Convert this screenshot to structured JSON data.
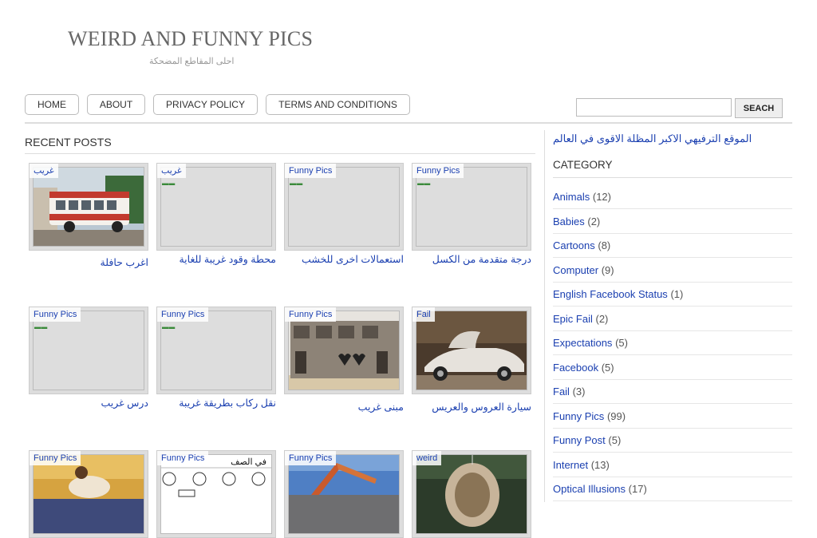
{
  "site": {
    "title": "WEIRD AND FUNNY PICS",
    "description": "احلى المقاطع المضحكة"
  },
  "nav": {
    "items": [
      "HOME",
      "ABOUT",
      "PRIVACY POLICY",
      "TERMS AND CONDITIONS"
    ]
  },
  "search": {
    "button_label": "SEACH",
    "value": ""
  },
  "recent": {
    "heading": "RECENT POSTS",
    "posts": [
      {
        "label": "غريب",
        "title": "اغرب حافلة",
        "image": "bus"
      },
      {
        "label": "غريب",
        "title": "محطة وقود غريبة للغاية",
        "image": "placeholder"
      },
      {
        "label": "Funny Pics",
        "title": "استعمالات اخرى للخشب",
        "image": "placeholder"
      },
      {
        "label": "Funny Pics",
        "title": "درجة متقدمة من الكسل",
        "image": "placeholder"
      },
      {
        "label": "Funny Pics",
        "title": "درس غريب",
        "image": "placeholder"
      },
      {
        "label": "Funny Pics",
        "title": "نقل ركاب بطريقة غريبة",
        "image": "placeholder"
      },
      {
        "label": "Funny Pics",
        "title": "مبنى غريب",
        "image": "building"
      },
      {
        "label": "Fail",
        "title": "سيارة العروس والعريس",
        "image": "car"
      },
      {
        "label": "Funny Pics",
        "title": "",
        "image": "kids"
      },
      {
        "label": "Funny Pics",
        "title": "",
        "image": "comic",
        "overlay_text": "في الصف"
      },
      {
        "label": "Funny Pics",
        "title": "",
        "image": "crane"
      },
      {
        "label": "weird",
        "title": "",
        "image": "basket"
      }
    ]
  },
  "sidebar": {
    "tagline": "الموقع الترفيهي الاكبر المظلة الاقوى في العالم",
    "category_heading": "CATEGORY",
    "categories": [
      {
        "name": "Animals",
        "count": "(12)"
      },
      {
        "name": "Babies",
        "count": "(2)"
      },
      {
        "name": "Cartoons",
        "count": "(8)"
      },
      {
        "name": "Computer",
        "count": "(9)"
      },
      {
        "name": "English Facebook Status",
        "count": "(1)"
      },
      {
        "name": "Epic Fail",
        "count": "(2)"
      },
      {
        "name": "Expectations",
        "count": "(5)"
      },
      {
        "name": "Facebook",
        "count": "(5)"
      },
      {
        "name": "Fail",
        "count": "(3)"
      },
      {
        "name": "Funny Pics",
        "count": "(99)"
      },
      {
        "name": "Funny Post",
        "count": "(5)"
      },
      {
        "name": "Internet",
        "count": "(13)"
      },
      {
        "name": "Optical Illusions",
        "count": "(17)"
      }
    ]
  },
  "colors": {
    "link": "#1a3fb0",
    "thumb_bg": "#dddddd",
    "border": "#dddddd"
  }
}
